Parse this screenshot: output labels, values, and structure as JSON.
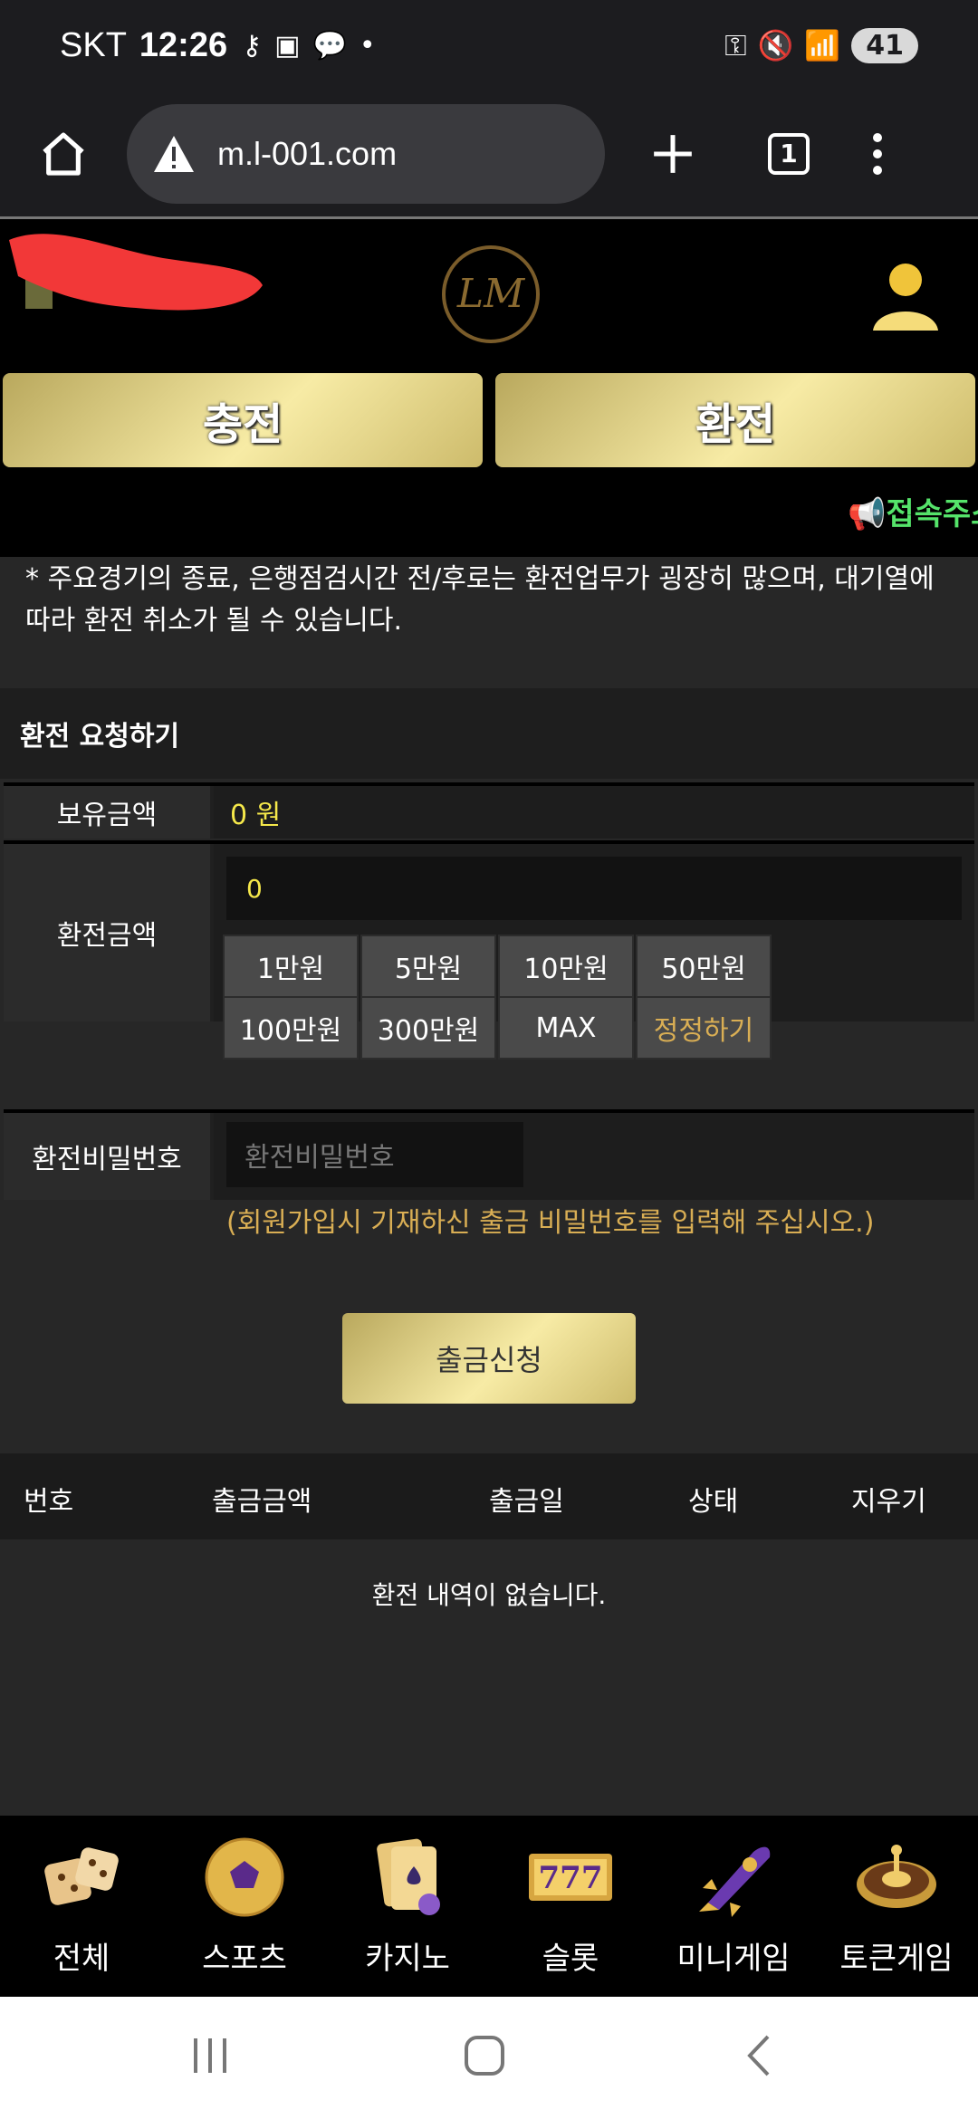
{
  "status_bar": {
    "carrier": "SKT",
    "time": "12:26",
    "battery": "41"
  },
  "browser": {
    "url": "m.l-001.com",
    "tab_count": "1"
  },
  "header": {
    "logo_text": "LM"
  },
  "actions": {
    "deposit_label": "충전",
    "withdraw_label": "환전"
  },
  "marquee": {
    "text": "📢접속주소"
  },
  "notice": "* 주요경기의 종료, 은행점검시간 전/후로는 환전업무가 굉장히 많으며, 대기열에 따라 환전 취소가 될 수 있습니다.",
  "form": {
    "title": "환전 요청하기",
    "balance_label": "보유금액",
    "balance_value": "0 원",
    "amount_label": "환전금액",
    "amount_value": "0",
    "amount_buttons": [
      "1만원",
      "5만원",
      "10만원",
      "50만원",
      "100만원",
      "300만원",
      "MAX",
      "정정하기"
    ],
    "password_label": "환전비밀번호",
    "password_placeholder": "환전비밀번호",
    "password_hint": "(회원가입시 기재하신 출금 비밀번호를 입력해 주십시오.)",
    "submit_label": "출금신청"
  },
  "history": {
    "columns": [
      "번호",
      "출금금액",
      "출금일",
      "상태",
      "지우기"
    ],
    "empty_message": "환전 내역이 없습니다."
  },
  "game_nav": {
    "items": [
      {
        "label": "전체",
        "icon": "dice-icon"
      },
      {
        "label": "스포츠",
        "icon": "soccer-ball-icon"
      },
      {
        "label": "카지노",
        "icon": "cards-icon"
      },
      {
        "label": "슬롯",
        "icon": "slot-777-icon"
      },
      {
        "label": "미니게임",
        "icon": "rocket-icon"
      },
      {
        "label": "토큰게임",
        "icon": "roulette-icon"
      }
    ]
  },
  "colors": {
    "gold_light": "#f7eba5",
    "gold_dark": "#b9a85d",
    "balance_yellow": "#f5e84a",
    "hint_orange": "#d9ae54",
    "marquee_green": "#55e36a"
  }
}
